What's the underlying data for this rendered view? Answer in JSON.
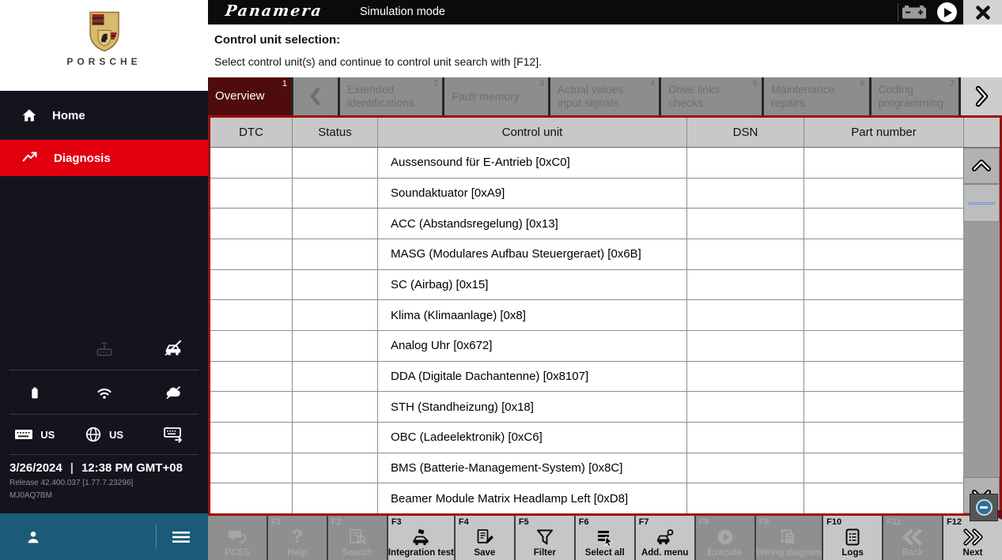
{
  "topbar": {
    "model": "Panamera",
    "mode": "Simulation mode"
  },
  "brand": {
    "wordmark": "PORSCHE"
  },
  "sidebar": {
    "nav": [
      {
        "label": "Home"
      },
      {
        "label": "Diagnosis"
      }
    ],
    "lang_keyboard": "US",
    "lang_region": "US",
    "date": "3/26/2024",
    "separator": "|",
    "time": "12:38 PM GMT+08",
    "release": "Release 42.400.037 [1.77.7.23296]",
    "device_id": "MJ0AQ7BM"
  },
  "instructions": {
    "title": "Control unit selection:",
    "subtitle": "Select control unit(s) and continue to control unit search with [F12]."
  },
  "tabbar": {
    "tabs": [
      {
        "label": "Overview",
        "number": "1"
      },
      {
        "label": "Extended identifications",
        "number": "2"
      },
      {
        "label": "Fault memory",
        "number": "3"
      },
      {
        "label": "Actual values input signals",
        "number": "4"
      },
      {
        "label": "Drive links checks",
        "number": "5"
      },
      {
        "label": "Maintenance repairs",
        "number": "6"
      },
      {
        "label": "Coding programming",
        "number": "7"
      }
    ]
  },
  "table": {
    "columns": [
      "DTC",
      "Status",
      "Control unit",
      "DSN",
      "Part number"
    ],
    "rows": [
      "Aussensound für E-Antrieb [0xC0]",
      "Soundaktuator [0xA9]",
      "ACC (Abstandsregelung) [0x13]",
      "MASG (Modulares Aufbau Steuergeraet) [0x6B]",
      "SC (Airbag) [0x15]",
      "Klima (Klimaanlage) [0x8]",
      "Analog Uhr [0x672]",
      "DDA (Digitale Dachantenne) [0x8107]",
      "STH (Standheizung) [0x18]",
      "OBC (Ladeelektronik) [0xC6]",
      "BMS (Batterie-Management-System) [0x8C]",
      "Beamer Module Matrix Headlamp Left [0xD8]"
    ]
  },
  "function_keys": [
    {
      "key": "",
      "label": "PCSS",
      "enabled": false
    },
    {
      "key": "F1",
      "label": "Help",
      "enabled": false
    },
    {
      "key": "F2",
      "label": "Search",
      "enabled": false
    },
    {
      "key": "F3",
      "label": "Integration test",
      "enabled": true
    },
    {
      "key": "F4",
      "label": "Save",
      "enabled": true
    },
    {
      "key": "F5",
      "label": "Filter",
      "enabled": true
    },
    {
      "key": "F6",
      "label": "Select all",
      "enabled": true
    },
    {
      "key": "F7",
      "label": "Add. menu",
      "enabled": true
    },
    {
      "key": "F8",
      "label": "Execute",
      "enabled": false
    },
    {
      "key": "F9",
      "label": "Wiring diagram",
      "enabled": false
    },
    {
      "key": "F10",
      "label": "Logs",
      "enabled": true
    },
    {
      "key": "F11",
      "label": "Back",
      "enabled": false
    },
    {
      "key": "F12",
      "label": "Next",
      "enabled": true
    }
  ],
  "colors": {
    "accent_red": "#e2000f",
    "active_tab_maroon": "#4f0c0c",
    "table_border_red": "#9e0e0e",
    "footer_teal": "#1b5a78",
    "sidebar_navy": "#14141f"
  }
}
